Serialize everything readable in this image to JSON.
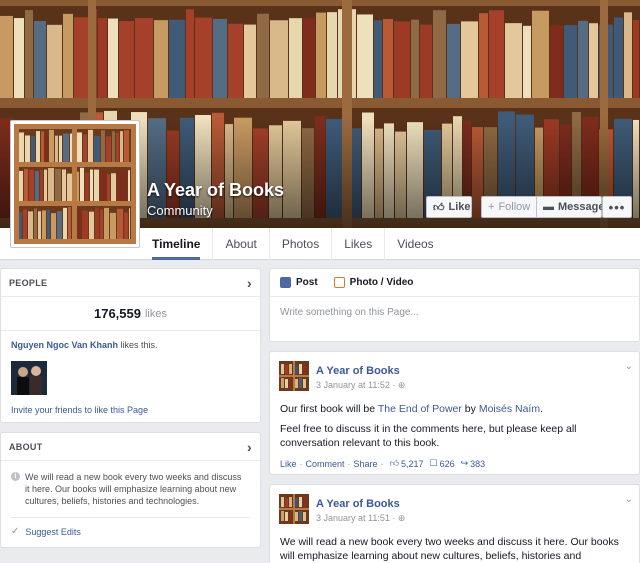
{
  "page": {
    "name": "A Year of Books",
    "category": "Community"
  },
  "cover_actions": {
    "like": "Like",
    "follow": "Follow",
    "message": "Message",
    "more": "•••"
  },
  "tabs": [
    {
      "label": "Timeline",
      "active": true
    },
    {
      "label": "About"
    },
    {
      "label": "Photos"
    },
    {
      "label": "Likes"
    },
    {
      "label": "Videos"
    }
  ],
  "people": {
    "header": "PEOPLE",
    "likes_count": "176,559",
    "likes_word": "likes",
    "friend_name": "Nguyen Ngoc Van Khanh",
    "friend_suffix": "likes this.",
    "invite": "Invite your friends to like this Page"
  },
  "about": {
    "header": "ABOUT",
    "description": "We will read a new book every two weeks and discuss it here. Our books will emphasize learning about new cultures, beliefs, histories and technologies.",
    "suggest_edits": "Suggest Edits"
  },
  "composer": {
    "post_tab": "Post",
    "photo_tab": "Photo / Video",
    "placeholder": "Write something on this Page..."
  },
  "posts": [
    {
      "author": "A Year of Books",
      "date": "3 January at 11:52 · ",
      "line1_prefix": "Our first book will be ",
      "line1_book": "The End of Power",
      "line1_mid": " by ",
      "line1_author": "Moisés Naím",
      "line1_suffix": ".",
      "line2": "Feel free to discuss it in the comments here, but please keep all conversation relevant to this book.",
      "action_like": "Like",
      "action_comment": "Comment",
      "action_share": "Share",
      "likes": "5,217",
      "comments": "626",
      "shares": "383"
    },
    {
      "author": "A Year of Books",
      "date": "3 January at 11:51 · ",
      "body": "We will read a new book every two weeks and discuss it here. Our books will emphasize learning about new cultures, beliefs, histories and"
    }
  ],
  "colors": {
    "link": "#3b5998",
    "tab_active": "#4e69a2",
    "wood": "#7a4526"
  }
}
